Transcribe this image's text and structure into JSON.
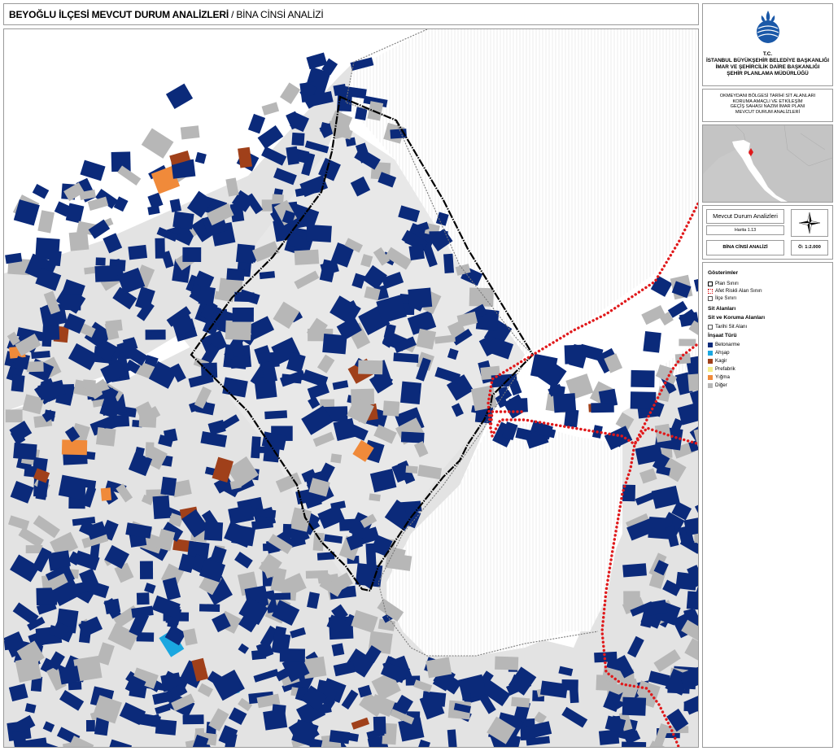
{
  "title": {
    "main": "BEYOĞLU İLÇESİ MEVCUT DURUM ANALİZLERİ",
    "separator": " / ",
    "sub": "BİNA CİNSİ ANALİZİ"
  },
  "institution": {
    "lines": [
      "T.C.",
      "İSTANBUL BÜYÜKŞEHİR BELEDİYE BAŞKANLIĞI",
      "İMAR VE ŞEHİRCİLİK DAİRE BAŞKANLIĞI",
      "ŞEHİR PLANLAMA MÜDÜRLÜĞÜ"
    ]
  },
  "project": {
    "lines": [
      "OKMEYDANI BÖLGESİ TARİHİ SİT ALANLARI",
      "KORUMA AMAÇLI VE ETKİLEŞİM",
      "GEÇİŞ SAHASI NAZIM İMAR PLANI",
      "MEVCUT DURUM ANALİZLERİ"
    ]
  },
  "sheet": {
    "title": "Mevcut Durum Analizleri",
    "map_no": "Harita 1.13",
    "name": "BİNA CİNSİ ANALİZİ",
    "scale": "Ö: 1:2.000"
  },
  "legend": {
    "heading": "Gösterimler",
    "boundaries": [
      {
        "label": "Plan Sınırı",
        "style": "plan"
      },
      {
        "label": "Afet Riskli Alan Sınırı",
        "style": "risk"
      },
      {
        "label": "İlçe Sınırı",
        "style": "district"
      }
    ],
    "sit_heading": "Sit Alanları",
    "sit_koruma_heading": "Sit ve Koruma Alanları",
    "sit_items": [
      {
        "label": "Tarihi Sit Alanı",
        "style": "historic"
      }
    ],
    "construction_heading": "İnşaat Türü",
    "construction_types": [
      {
        "label": "Betonarme",
        "color": "#0b2a7a"
      },
      {
        "label": "Ahşap",
        "color": "#1aa7e0"
      },
      {
        "label": "Kagir",
        "color": "#a0401a"
      },
      {
        "label": "Prefabrik",
        "color": "#f4ee8a"
      },
      {
        "label": "Yığma",
        "color": "#f08a3a"
      },
      {
        "label": "Diğer",
        "color": "#b7b7b7"
      }
    ]
  },
  "icons": {
    "logo": "ibb-tulip-logo",
    "north_arrow": "compass-rose-icon"
  },
  "colors": {
    "betonarme": "#0b2a7a",
    "other": "#b7b7b7",
    "road": "#dcdcdc",
    "risk_boundary": "#e0191b",
    "plan_boundary": "#000000"
  }
}
